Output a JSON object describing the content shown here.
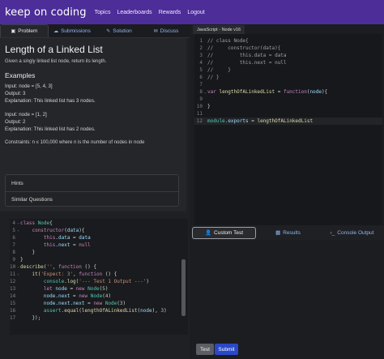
{
  "nav": {
    "brand": "keep on coding",
    "links": [
      "Topics",
      "Leaderboards",
      "Rewards",
      "Logout"
    ]
  },
  "problem_tabs": [
    {
      "label": "Problem",
      "icon": "document-icon"
    },
    {
      "label": "Submissions",
      "icon": "cloud-upload-icon"
    },
    {
      "label": "Solution",
      "icon": "lightbulb-icon"
    },
    {
      "label": "Discuss",
      "icon": "chat-icon"
    }
  ],
  "problem": {
    "title": "Length of a Linked List",
    "description": "Given a singly linked list node, return its length.",
    "examples_heading": "Examples",
    "example1": [
      "Input: node = [5, 4, 3]",
      "Output: 3",
      "Explanation: This linked list has 3 nodes."
    ],
    "example2": [
      "Input: node = [1, 2]",
      "Output: 2",
      "Explanation: This linked list has 2 nodes."
    ],
    "constraints": "Constraints: n ≤ 100,000 where n is the number of nodes in node"
  },
  "accordion": [
    "Hints",
    "Similar Questions"
  ],
  "editor": {
    "tab_label": "JavaScript - Node v16",
    "lines": [
      {
        "n": "1",
        "fold": "",
        "html": "<span class='c-com'>// class Node{</span>"
      },
      {
        "n": "2",
        "fold": "",
        "html": "<span class='c-com'>//     constructor(data){</span>"
      },
      {
        "n": "3",
        "fold": "",
        "html": "<span class='c-com'>//         this.data = data</span>"
      },
      {
        "n": "4",
        "fold": "",
        "html": "<span class='c-com'>//         this.next = null</span>"
      },
      {
        "n": "5",
        "fold": "",
        "html": "<span class='c-com'>//     }</span>"
      },
      {
        "n": "6",
        "fold": "",
        "html": "<span class='c-com'>// }</span>"
      },
      {
        "n": "7",
        "fold": "",
        "html": ""
      },
      {
        "n": "8",
        "fold": "⌄",
        "html": "<span class='c-kw'>var</span> <span class='c-fn'>lengthOfALinkedList</span> = <span class='c-kw'>function</span>(<span class='c-prop'>node</span>){"
      },
      {
        "n": "9",
        "fold": "",
        "html": ""
      },
      {
        "n": "10",
        "fold": "",
        "html": "}"
      },
      {
        "n": "11",
        "fold": "",
        "html": ""
      },
      {
        "n": "12",
        "fold": "",
        "html": "<span class='c-obj'>module</span>.<span class='c-prop'>exports</span> = <span class='c-fn'>lengthOfALinkedList</span>"
      }
    ]
  },
  "test_tabs": [
    {
      "label": "Custom Test",
      "icon": "user-icon"
    },
    {
      "label": "Results",
      "icon": "chart-icon"
    },
    {
      "label": "Console Output",
      "icon": "terminal-icon"
    }
  ],
  "test_code": {
    "lines": [
      {
        "n": "4",
        "fold": "⌄",
        "html": "<span class='c-kw'>class</span> <span class='c-obj'>Node</span>{"
      },
      {
        "n": "5",
        "fold": "⌄",
        "html": "    <span class='c-kw'>constructor</span>(<span class='c-prop'>data</span>){"
      },
      {
        "n": "6",
        "fold": "",
        "html": "        <span class='c-kw'>this</span>.<span class='c-prop'>data</span> = <span class='c-prop'>data</span>"
      },
      {
        "n": "7",
        "fold": "",
        "html": "        <span class='c-kw'>this</span>.<span class='c-prop'>next</span> = <span class='c-kw'>null</span>"
      },
      {
        "n": "8",
        "fold": "",
        "html": "    }"
      },
      {
        "n": "9",
        "fold": "",
        "html": "}"
      },
      {
        "n": "10",
        "fold": "⌄",
        "html": "<span class='c-fn'>describe</span>(<span class='c-str'>''</span>, <span class='c-kw'>function</span> () {"
      },
      {
        "n": "11",
        "fold": "⌄",
        "html": "    <span class='c-fn'>it</span>(<span class='c-str'>'Expect: 3'</span>, <span class='c-kw'>function</span> () {"
      },
      {
        "n": "12",
        "fold": "",
        "html": "        <span class='c-obj'>console</span>.<span class='c-fn'>log</span>(<span class='c-str'>'--- Test 1 Output ---'</span>)"
      },
      {
        "n": "13",
        "fold": "",
        "html": "        <span class='c-kw'>let</span> <span class='c-prop'>node</span> = <span class='c-kw'>new</span> <span class='c-obj'>Node</span>(<span class='c-num'>5</span>)"
      },
      {
        "n": "14",
        "fold": "",
        "html": "        <span class='c-prop'>node</span>.<span class='c-prop'>next</span> = <span class='c-kw'>new</span> <span class='c-obj'>Node</span>(<span class='c-num'>4</span>)"
      },
      {
        "n": "15",
        "fold": "",
        "html": "        <span class='c-prop'>node</span>.<span class='c-prop'>next</span>.<span class='c-prop'>next</span> = <span class='c-kw'>new</span> <span class='c-obj'>Node</span>(<span class='c-num'>3</span>)"
      },
      {
        "n": "16",
        "fold": "",
        "html": "        <span class='c-obj'>assert</span>.<span class='c-fn'>equal</span>(<span class='c-fn'>lengthOfALinkedList</span>(<span class='c-prop'>node</span>), <span class='c-num'>3</span>)"
      },
      {
        "n": "17",
        "fold": "",
        "html": "    });"
      }
    ]
  },
  "buttons": {
    "test": "Test",
    "submit": "Submit"
  }
}
